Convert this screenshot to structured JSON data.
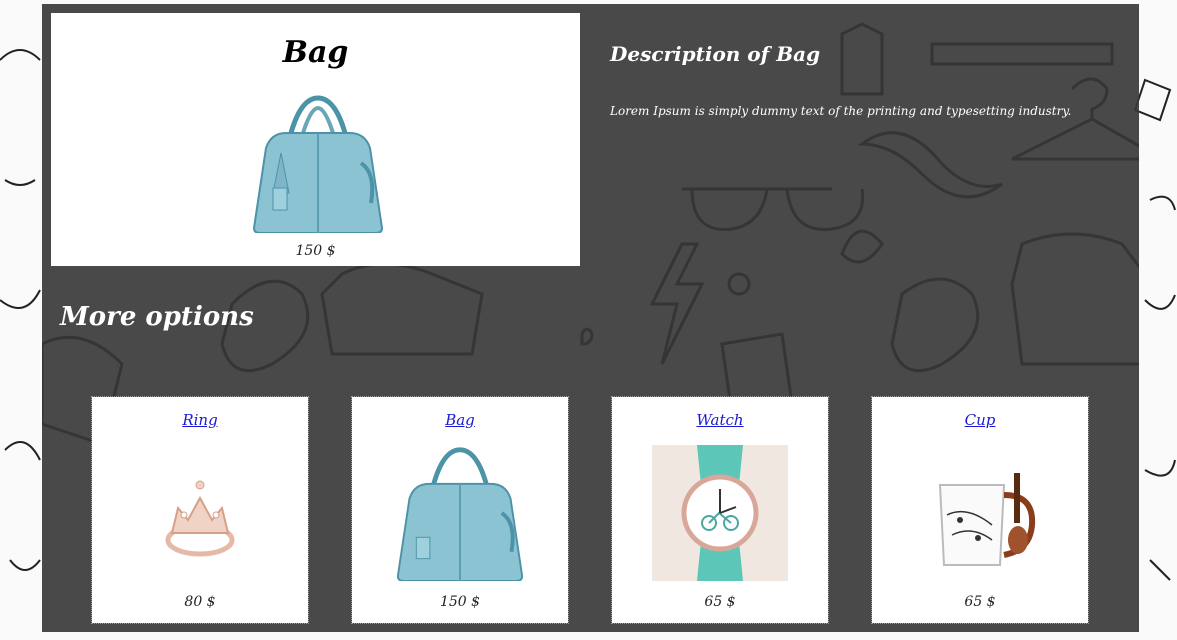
{
  "product": {
    "title": "Bag",
    "price": "150 $",
    "image_icon": "handbag-icon"
  },
  "description": {
    "title": "Description of Bag",
    "text": "Lorem Ipsum is simply dummy text of the printing and typesetting industry."
  },
  "more_options": {
    "title": "More options",
    "items": [
      {
        "name": "Ring",
        "price": "80 $",
        "icon": "ring-icon"
      },
      {
        "name": "Bag",
        "price": "150 $",
        "icon": "handbag-icon"
      },
      {
        "name": "Watch",
        "price": "65 $",
        "icon": "watch-icon"
      },
      {
        "name": "Cup",
        "price": "65 $",
        "icon": "cup-icon"
      }
    ]
  },
  "colors": {
    "panel": "#3a3a3a",
    "bag": "#7fb6c7",
    "link": "#1a1ad6"
  }
}
